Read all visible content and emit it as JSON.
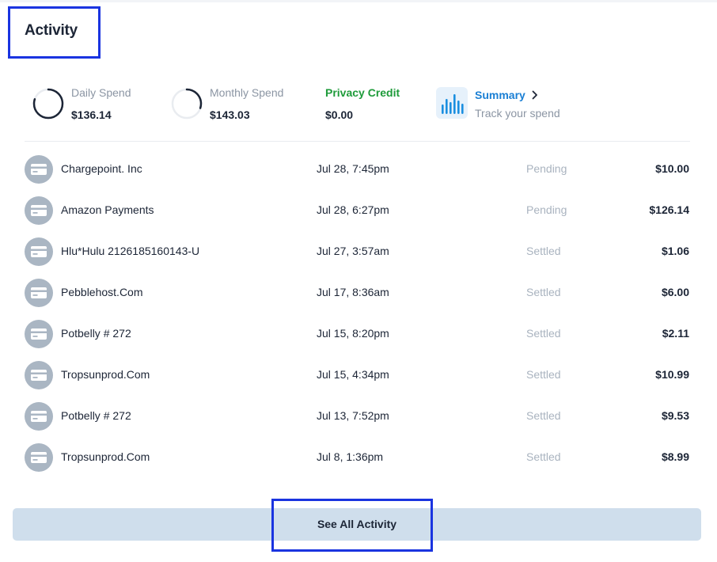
{
  "header": {
    "title": "Activity"
  },
  "stats": {
    "daily": {
      "label": "Daily Spend",
      "value": "$136.14",
      "ring_progress": 0.8
    },
    "monthly": {
      "label": "Monthly Spend",
      "value": "$143.03",
      "ring_progress": 0.3
    },
    "privacy_credit": {
      "label": "Privacy Credit",
      "value": "$0.00"
    },
    "summary": {
      "link": "Summary",
      "subtitle": "Track your spend"
    }
  },
  "transactions": [
    {
      "merchant": "Chargepoint. Inc",
      "date": "Jul 28, 7:45pm",
      "status": "Pending",
      "amount": "$10.00"
    },
    {
      "merchant": "Amazon Payments",
      "date": "Jul 28, 6:27pm",
      "status": "Pending",
      "amount": "$126.14"
    },
    {
      "merchant": "Hlu*Hulu 2126185160143-U",
      "date": "Jul 27, 3:57am",
      "status": "Settled",
      "amount": "$1.06"
    },
    {
      "merchant": "Pebblehost.Com",
      "date": "Jul 17, 8:36am",
      "status": "Settled",
      "amount": "$6.00"
    },
    {
      "merchant": "Potbelly # 272",
      "date": "Jul 15, 8:20pm",
      "status": "Settled",
      "amount": "$2.11"
    },
    {
      "merchant": "Tropsunprod.Com",
      "date": "Jul 15, 4:34pm",
      "status": "Settled",
      "amount": "$10.99"
    },
    {
      "merchant": "Potbelly # 272",
      "date": "Jul 13, 7:52pm",
      "status": "Settled",
      "amount": "$9.53"
    },
    {
      "merchant": "Tropsunprod.Com",
      "date": "Jul 8, 1:36pm",
      "status": "Settled",
      "amount": "$8.99"
    }
  ],
  "footer": {
    "see_all_label": "See All Activity"
  },
  "icons": {
    "ring": "progress-ring",
    "summary": "bar-chart-icon",
    "chevron": "chevron-right-icon",
    "card": "credit-card-icon"
  },
  "colors": {
    "accent_blue": "#1a7fd4",
    "privacy_green": "#1e9b3a",
    "highlight_outline": "#1a34e0",
    "button_bg": "#cfdeec",
    "card_icon_bg": "#aab6c3"
  }
}
